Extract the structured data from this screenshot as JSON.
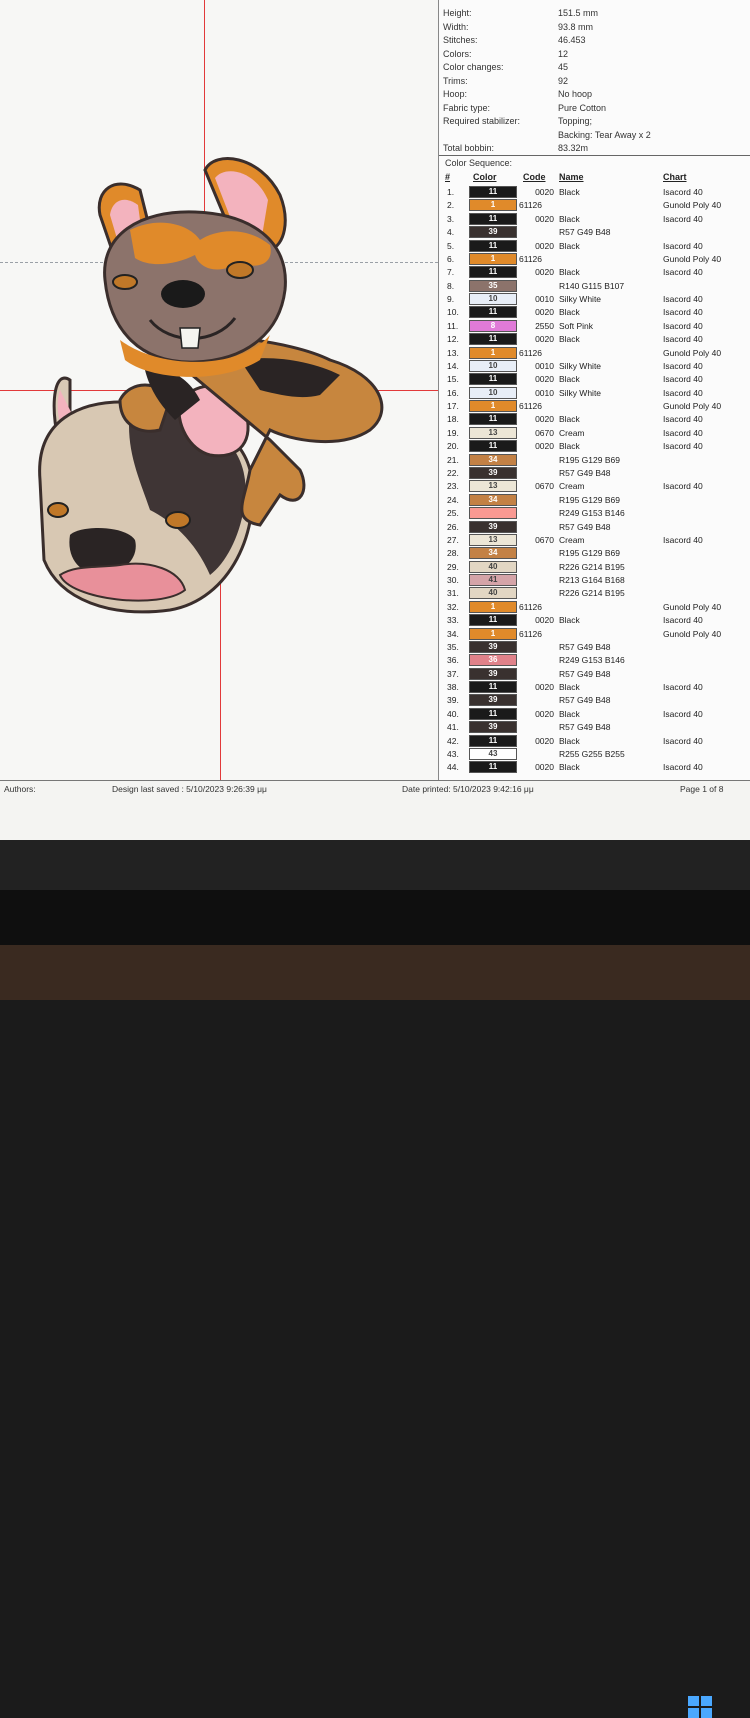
{
  "design_info": {
    "rows": [
      {
        "label": "Height:",
        "value": "151.5 mm"
      },
      {
        "label": "Width:",
        "value": "93.8 mm"
      },
      {
        "label": "Stitches:",
        "value": "46.453"
      },
      {
        "label": "Colors:",
        "value": "12"
      },
      {
        "label": "Color changes:",
        "value": "45"
      },
      {
        "label": "Trims:",
        "value": "92"
      },
      {
        "label": "Hoop:",
        "value": "No hoop"
      },
      {
        "label": "Fabric type:",
        "value": "Pure Cotton"
      },
      {
        "label": "Required stabilizer:",
        "value": "Topping;"
      },
      {
        "label": "",
        "value": "Backing: Tear Away x 2"
      },
      {
        "label": "Total bobbin:",
        "value": "83.32m"
      }
    ]
  },
  "sequence": {
    "title": "Color Sequence:",
    "headers": {
      "num": "#",
      "color": "Color",
      "code": "Code",
      "name": "Name",
      "chart": "Chart"
    },
    "rows": [
      {
        "n": "1.",
        "sw": "11",
        "c": "#1a1a1a",
        "code": "0020",
        "name": "Black",
        "chart": "Isacord 40"
      },
      {
        "n": "2.",
        "sw": "1",
        "c": "#e08a2a",
        "code": "61126",
        "name": "",
        "chart": "Gunold Poly 40"
      },
      {
        "n": "3.",
        "sw": "11",
        "c": "#1a1a1a",
        "code": "0020",
        "name": "Black",
        "chart": "Isacord 40"
      },
      {
        "n": "4.",
        "sw": "39",
        "c": "#39312f",
        "code": "",
        "name": "R57 G49 B48",
        "chart": ""
      },
      {
        "n": "5.",
        "sw": "11",
        "c": "#1a1a1a",
        "code": "0020",
        "name": "Black",
        "chart": "Isacord 40"
      },
      {
        "n": "6.",
        "sw": "1",
        "c": "#e08a2a",
        "code": "61126",
        "name": "",
        "chart": "Gunold Poly 40"
      },
      {
        "n": "7.",
        "sw": "11",
        "c": "#1a1a1a",
        "code": "0020",
        "name": "Black",
        "chart": "Isacord 40"
      },
      {
        "n": "8.",
        "sw": "35",
        "c": "#8c736b",
        "code": "",
        "name": "R140 G115 B107",
        "chart": ""
      },
      {
        "n": "9.",
        "sw": "10",
        "c": "#e8eef7",
        "code": "0010",
        "name": "Silky White",
        "chart": "Isacord 40"
      },
      {
        "n": "10.",
        "sw": "11",
        "c": "#1a1a1a",
        "code": "0020",
        "name": "Black",
        "chart": "Isacord 40"
      },
      {
        "n": "11.",
        "sw": "8",
        "c": "#e07ad8",
        "code": "2550",
        "name": "Soft Pink",
        "chart": "Isacord 40"
      },
      {
        "n": "12.",
        "sw": "11",
        "c": "#1a1a1a",
        "code": "0020",
        "name": "Black",
        "chart": "Isacord 40"
      },
      {
        "n": "13.",
        "sw": "1",
        "c": "#e08a2a",
        "code": "61126",
        "name": "",
        "chart": "Gunold Poly 40"
      },
      {
        "n": "14.",
        "sw": "10",
        "c": "#e8eef7",
        "code": "0010",
        "name": "Silky White",
        "chart": "Isacord 40"
      },
      {
        "n": "15.",
        "sw": "11",
        "c": "#1a1a1a",
        "code": "0020",
        "name": "Black",
        "chart": "Isacord 40"
      },
      {
        "n": "16.",
        "sw": "10",
        "c": "#e8eef7",
        "code": "0010",
        "name": "Silky White",
        "chart": "Isacord 40"
      },
      {
        "n": "17.",
        "sw": "1",
        "c": "#e08a2a",
        "code": "61126",
        "name": "",
        "chart": "Gunold Poly 40"
      },
      {
        "n": "18.",
        "sw": "11",
        "c": "#1a1a1a",
        "code": "0020",
        "name": "Black",
        "chart": "Isacord 40"
      },
      {
        "n": "19.",
        "sw": "13",
        "c": "#ece6d6",
        "code": "0670",
        "name": "Cream",
        "chart": "Isacord 40"
      },
      {
        "n": "20.",
        "sw": "11",
        "c": "#1a1a1a",
        "code": "0020",
        "name": "Black",
        "chart": "Isacord 40"
      },
      {
        "n": "21.",
        "sw": "34",
        "c": "#c38145",
        "code": "",
        "name": "R195 G129 B69",
        "chart": ""
      },
      {
        "n": "22.",
        "sw": "39",
        "c": "#39312f",
        "code": "",
        "name": "R57 G49 B48",
        "chart": ""
      },
      {
        "n": "23.",
        "sw": "13",
        "c": "#ece6d6",
        "code": "0670",
        "name": "Cream",
        "chart": "Isacord 40"
      },
      {
        "n": "24.",
        "sw": "34",
        "c": "#c38145",
        "code": "",
        "name": "R195 G129 B69",
        "chart": ""
      },
      {
        "n": "25.",
        "sw": "",
        "c": "#f99992",
        "code": "",
        "name": "R249 G153 B146",
        "chart": ""
      },
      {
        "n": "26.",
        "sw": "39",
        "c": "#39312f",
        "code": "",
        "name": "R57 G49 B48",
        "chart": ""
      },
      {
        "n": "27.",
        "sw": "13",
        "c": "#ece6d6",
        "code": "0670",
        "name": "Cream",
        "chart": "Isacord 40"
      },
      {
        "n": "28.",
        "sw": "34",
        "c": "#c38145",
        "code": "",
        "name": "R195 G129 B69",
        "chart": ""
      },
      {
        "n": "29.",
        "sw": "40",
        "c": "#e2d6c3",
        "code": "",
        "name": "R226 G214 B195",
        "chart": ""
      },
      {
        "n": "30.",
        "sw": "41",
        "c": "#d5a4a8",
        "code": "",
        "name": "R213 G164 B168",
        "chart": ""
      },
      {
        "n": "31.",
        "sw": "40",
        "c": "#e2d6c3",
        "code": "",
        "name": "R226 G214 B195",
        "chart": ""
      },
      {
        "n": "32.",
        "sw": "1",
        "c": "#e08a2a",
        "code": "61126",
        "name": "",
        "chart": "Gunold Poly 40"
      },
      {
        "n": "33.",
        "sw": "11",
        "c": "#1a1a1a",
        "code": "0020",
        "name": "Black",
        "chart": "Isacord 40"
      },
      {
        "n": "34.",
        "sw": "1",
        "c": "#e08a2a",
        "code": "61126",
        "name": "",
        "chart": "Gunold Poly 40"
      },
      {
        "n": "35.",
        "sw": "39",
        "c": "#39312f",
        "code": "",
        "name": "R57 G49 B48",
        "chart": ""
      },
      {
        "n": "36.",
        "sw": "36",
        "c": "#e0828a",
        "code": "",
        "name": "R249 G153 B146",
        "chart": ""
      },
      {
        "n": "37.",
        "sw": "39",
        "c": "#39312f",
        "code": "",
        "name": "R57 G49 B48",
        "chart": ""
      },
      {
        "n": "38.",
        "sw": "11",
        "c": "#1a1a1a",
        "code": "0020",
        "name": "Black",
        "chart": "Isacord 40"
      },
      {
        "n": "39.",
        "sw": "39",
        "c": "#39312f",
        "code": "",
        "name": "R57 G49 B48",
        "chart": ""
      },
      {
        "n": "40.",
        "sw": "11",
        "c": "#1a1a1a",
        "code": "0020",
        "name": "Black",
        "chart": "Isacord 40"
      },
      {
        "n": "41.",
        "sw": "39",
        "c": "#39312f",
        "code": "",
        "name": "R57 G49 B48",
        "chart": ""
      },
      {
        "n": "42.",
        "sw": "11",
        "c": "#1a1a1a",
        "code": "0020",
        "name": "Black",
        "chart": "Isacord 40"
      },
      {
        "n": "43.",
        "sw": "43",
        "c": "#ffffff",
        "code": "",
        "name": "R255 G255 B255",
        "chart": ""
      },
      {
        "n": "44.",
        "sw": "11",
        "c": "#1a1a1a",
        "code": "0020",
        "name": "Black",
        "chart": "Isacord 40"
      }
    ]
  },
  "footer": {
    "authors": "Authors:",
    "saved": "Design last saved : 5/10/2023 9:26:39 μμ",
    "printed": "Date printed: 5/10/2023 9:42:16 μμ",
    "page": "Page 1 of 8"
  },
  "colors": {
    "guide": "#e23a3a",
    "orange": "#e08a2a",
    "brown": "#8c736b"
  }
}
